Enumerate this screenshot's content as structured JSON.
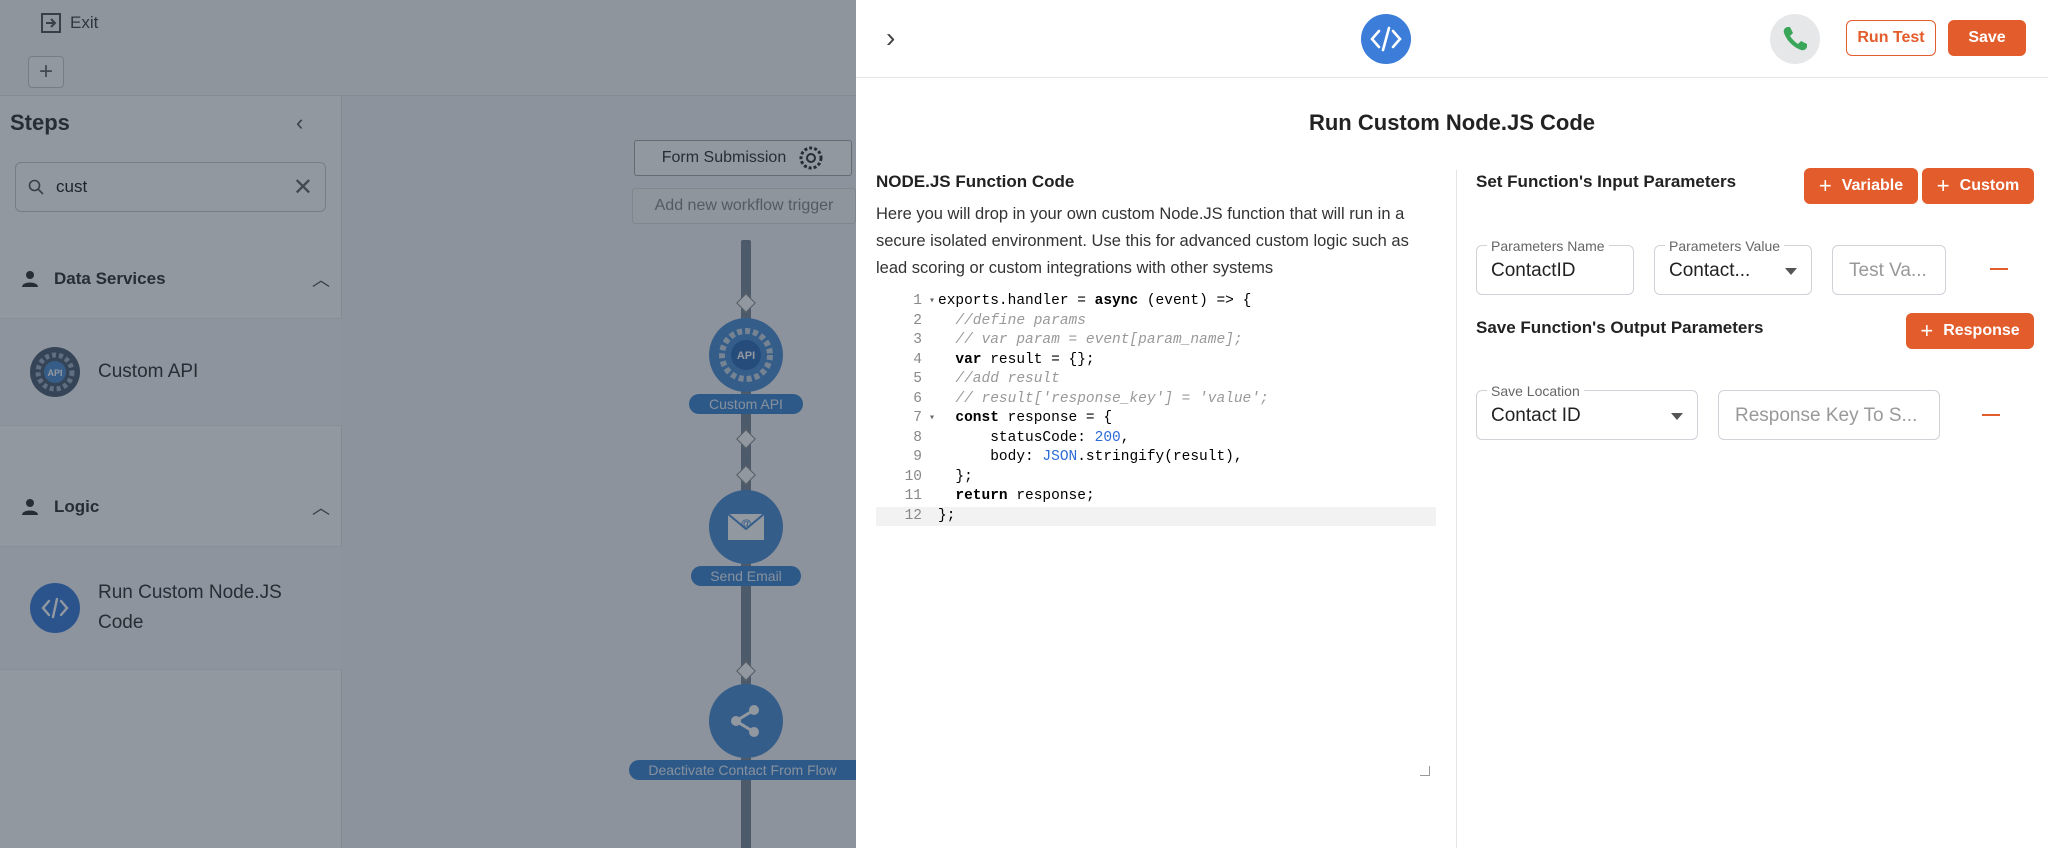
{
  "topbar": {
    "exit_label": "Exit"
  },
  "steps": {
    "title": "Steps",
    "search": {
      "value": "cust",
      "placeholder": ""
    },
    "categories": [
      {
        "label": "Data Services",
        "items": [
          {
            "label": "Custom API"
          }
        ]
      },
      {
        "label": "Logic",
        "items": [
          {
            "label": "Run Custom Node.JS Code"
          }
        ]
      }
    ]
  },
  "canvas": {
    "trigger_label": "Form Submission",
    "add_trigger_label": "Add new workflow trigger",
    "nodes": [
      {
        "label": "Custom API",
        "badge": "API"
      },
      {
        "label": "Send Email"
      },
      {
        "label": "Deactivate Contact From Flow"
      }
    ]
  },
  "panel": {
    "title": "Run Custom Node.JS Code",
    "run_test_label": "Run Test",
    "save_label": "Save",
    "code_section": {
      "heading": "NODE.JS Function Code",
      "description": "Here you will drop in your own custom Node.JS function that will run in a secure isolated environment. Use this for advanced custom logic such as lead scoring or custom integrations with other systems",
      "lines": [
        "exports.handler = async (event) => {",
        "  //define params",
        "  // var param = event[param_name];",
        "  var result = {};",
        "  //add result",
        "  // result['response_key'] = 'value';",
        "  const response = {",
        "      statusCode: 200,",
        "      body: JSON.stringify(result),",
        "  };",
        "  return response;",
        "};"
      ]
    },
    "input_params": {
      "title": "Set Function's Input Parameters",
      "variable_btn": "Variable",
      "custom_btn": "Custom",
      "name_label": "Parameters Name",
      "name_value": "ContactID",
      "value_label": "Parameters Value",
      "value_value": "Contact...",
      "test_placeholder": "Test Va..."
    },
    "output_params": {
      "title": "Save Function's Output Parameters",
      "response_btn": "Response",
      "location_label": "Save Location",
      "location_value": "Contact ID",
      "key_placeholder": "Response Key To S..."
    }
  },
  "colors": {
    "accent": "#e35c2c",
    "brand_blue": "#3b7dd8",
    "phone_green": "#3aa65a"
  }
}
